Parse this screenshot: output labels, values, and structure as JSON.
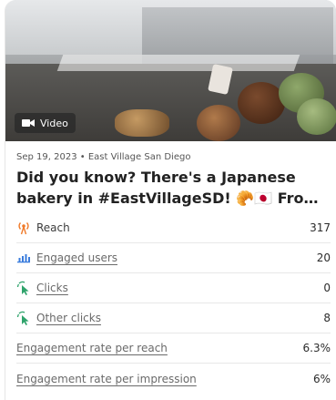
{
  "post": {
    "media_badge": "Video",
    "date": "Sep 19, 2023",
    "location": "East Village San Diego",
    "title_line1": "Did you know? There's a Japanese",
    "title_line2": "bakery in #EastVillageSD! 🥐🇯🇵 Fro…"
  },
  "metrics": [
    {
      "label": "Reach",
      "value": "317",
      "icon": "broadcast-icon",
      "link": false
    },
    {
      "label": "Engaged users",
      "value": "20",
      "icon": "bar-chart-icon",
      "link": true
    },
    {
      "label": "Clicks",
      "value": "0",
      "icon": "cursor-click-icon",
      "link": true
    },
    {
      "label": "Other clicks",
      "value": "8",
      "icon": "cursor-click-icon",
      "link": true
    },
    {
      "label": "Engagement rate per reach",
      "value": "6.3%",
      "icon": "",
      "link": true
    },
    {
      "label": "Engagement rate per impression",
      "value": "6%",
      "icon": "",
      "link": true
    }
  ],
  "colors": {
    "reach_icon": "#f07b2b",
    "engaged_icon": "#3b7ddd",
    "click_icon": "#2fa36b"
  }
}
